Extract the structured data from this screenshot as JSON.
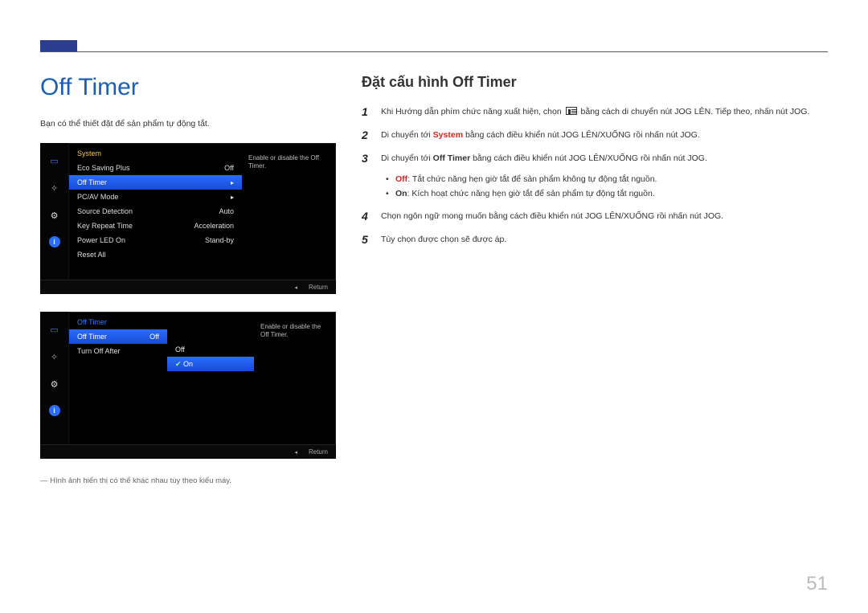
{
  "page_title": "Off Timer",
  "intro": "Bạn có thể thiết đặt để sản phẩm tự động tắt.",
  "footnote": "― Hình ảnh hiển thị có thể khác nhau tùy theo kiểu máy.",
  "page_number": "51",
  "right": {
    "heading": "Đặt cấu hình Off Timer",
    "steps": {
      "s1_a": "Khi Hướng dẫn phím chức năng xuất hiện, chọn ",
      "s1_b": " bằng cách di chuyển nút JOG LÊN. Tiếp theo, nhấn nút JOG.",
      "s2_a": "Di chuyển tới ",
      "s2_system": "System",
      "s2_b": " bằng cách điều khiển nút JOG LÊN/XUỐNG rồi nhấn nút JOG.",
      "s3_a": "Di chuyển tới ",
      "s3_offtimer": "Off Timer",
      "s3_b": " bằng cách điều khiển nút JOG LÊN/XUỐNG rồi nhấn nút JOG.",
      "s4": "Chọn ngôn ngữ mong muốn bằng cách điều khiển nút JOG LÊN/XUỐNG rồi nhấn nút JOG.",
      "s5": "Tùy chọn được chọn sẽ được áp."
    },
    "bullets": {
      "off_label": "Off",
      "off_text": ": Tắt chức năng hẹn giờ tắt để sản phẩm không tự động tắt nguồn.",
      "on_label": "On",
      "on_text": ": Kích hoạt chức năng hẹn giờ tắt để sản phẩm tự động tắt nguồn."
    }
  },
  "osd1": {
    "title": "System",
    "tooltip": "Enable or disable the Off Timer.",
    "rows": {
      "r1": {
        "label": "Eco Saving Plus",
        "value": "Off"
      },
      "r2": {
        "label": "Off Timer",
        "value": "▸"
      },
      "r3": {
        "label": "PC/AV Mode",
        "value": "▸"
      },
      "r4": {
        "label": "Source Detection",
        "value": "Auto"
      },
      "r5": {
        "label": "Key Repeat Time",
        "value": "Acceleration"
      },
      "r6": {
        "label": "Power LED On",
        "value": "Stand-by"
      },
      "r7": {
        "label": "Reset All",
        "value": ""
      }
    },
    "return": "Return"
  },
  "osd2": {
    "title": "Off Timer",
    "tooltip": "Enable or disable the Off Timer.",
    "rows": {
      "r1": {
        "label": "Off Timer",
        "value": "Off"
      },
      "r2": {
        "label": "Turn Off After",
        "value": ""
      }
    },
    "options": {
      "o1": "Off",
      "o2": "On"
    },
    "return": "Return"
  }
}
